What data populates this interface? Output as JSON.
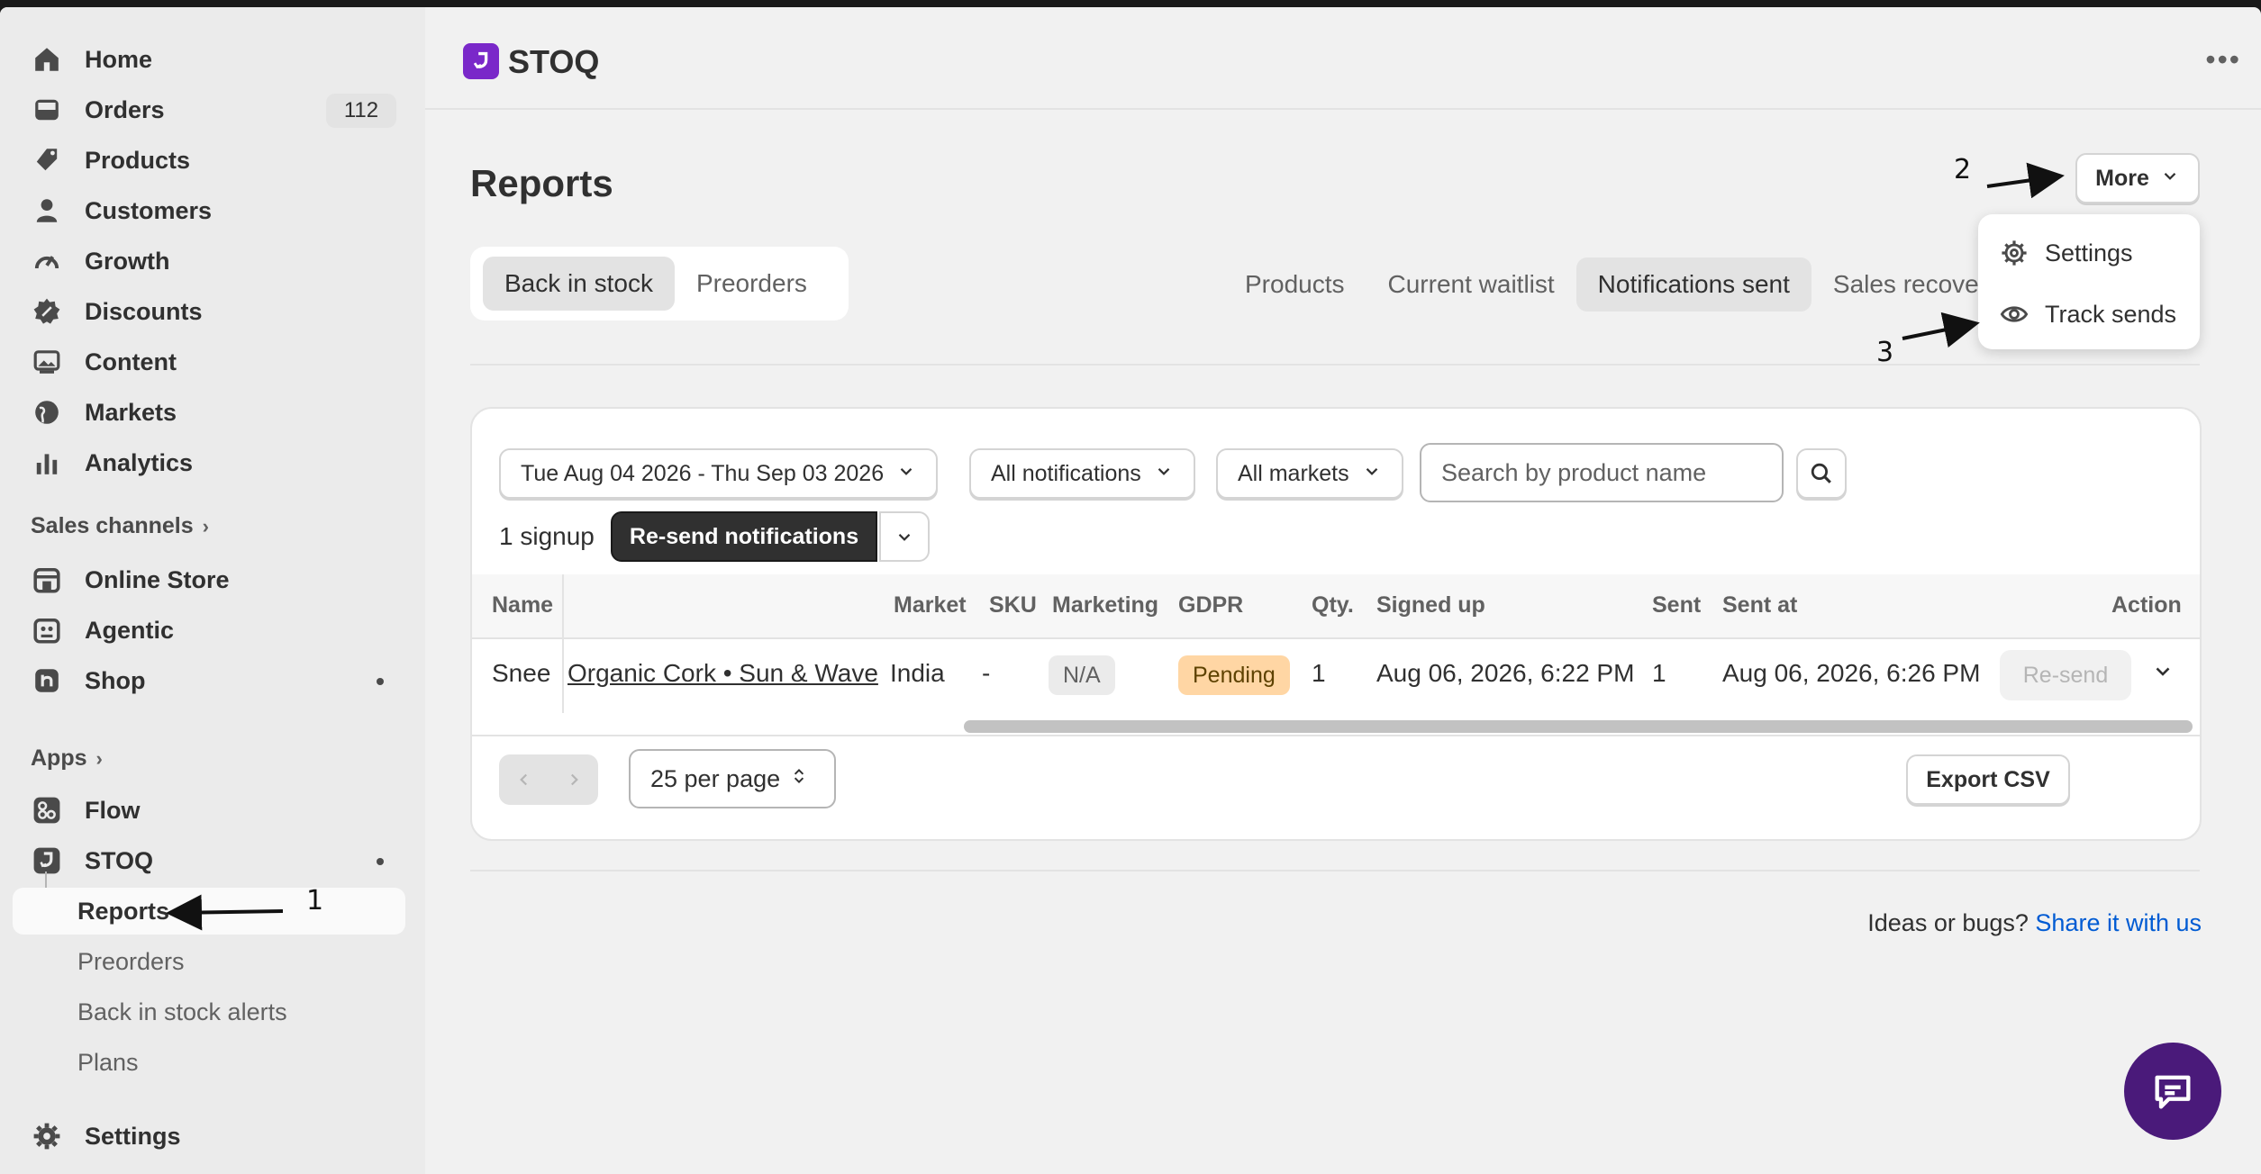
{
  "sidebar": {
    "items": [
      {
        "label": "Home",
        "icon": "home-icon"
      },
      {
        "label": "Orders",
        "icon": "inbox-icon",
        "badge": "112"
      },
      {
        "label": "Products",
        "icon": "tag-icon"
      },
      {
        "label": "Customers",
        "icon": "person-icon"
      },
      {
        "label": "Growth",
        "icon": "gauge-icon"
      },
      {
        "label": "Discounts",
        "icon": "discount-icon"
      },
      {
        "label": "Content",
        "icon": "image-icon"
      },
      {
        "label": "Markets",
        "icon": "globe-icon"
      },
      {
        "label": "Analytics",
        "icon": "bar-chart-icon"
      }
    ],
    "sales_channels_label": "Sales channels",
    "channels": [
      {
        "label": "Online Store",
        "icon": "store-icon"
      },
      {
        "label": "Agentic",
        "icon": "robot-icon"
      },
      {
        "label": "Shop",
        "icon": "shop-icon"
      }
    ],
    "apps_label": "Apps",
    "apps": [
      {
        "label": "Flow",
        "icon": "flow-icon"
      },
      {
        "label": "STOQ",
        "icon": "stoq-icon"
      }
    ],
    "stoq_sub": [
      "Reports",
      "Preorders",
      "Back in stock alerts",
      "Plans"
    ],
    "settings_label": "Settings"
  },
  "header": {
    "app_name": "STOQ",
    "more_label": "More",
    "popover": [
      "Settings",
      "Track sends"
    ]
  },
  "page": {
    "title": "Reports",
    "segments": [
      "Back in stock",
      "Preorders"
    ],
    "tabs": [
      "Products",
      "Current waitlist",
      "Notifications sent",
      "Sales recove"
    ]
  },
  "filters": {
    "date_range": "Tue Aug 04 2026 - Thu Sep 03 2026",
    "notifications": "All notifications",
    "markets": "All markets",
    "search_placeholder": "Search by product name"
  },
  "bulk": {
    "count_label": "1 signup",
    "resend_label": "Re-send notifications"
  },
  "table": {
    "columns": [
      "Name",
      "Market",
      "SKU",
      "Marketing",
      "GDPR",
      "Qty.",
      "Signed up",
      "Sent",
      "Sent at",
      "Action"
    ],
    "rows": [
      {
        "name": "Snee",
        "product": "Organic Cork • Sun & Wave",
        "market": "India",
        "sku": "-",
        "marketing": "N/A",
        "gdpr": "Pending",
        "qty": "1",
        "signed_up": "Aug 06, 2026, 6:22 PM",
        "sent": "1",
        "sent_at": "Aug 06, 2026, 6:26 PM",
        "action": "Re-send"
      }
    ]
  },
  "footer": {
    "per_page": "25 per page",
    "export_label": "Export CSV",
    "feedback_text": "Ideas or bugs?",
    "feedback_link": "Share it with us"
  },
  "annotations": [
    "1",
    "2",
    "3"
  ],
  "colors": {
    "accent": "#7a28c9",
    "primary_button": "#303030",
    "pending_badge": "#ffd6a4",
    "link": "#005bd3",
    "chat_fab": "#4a1a7a"
  }
}
